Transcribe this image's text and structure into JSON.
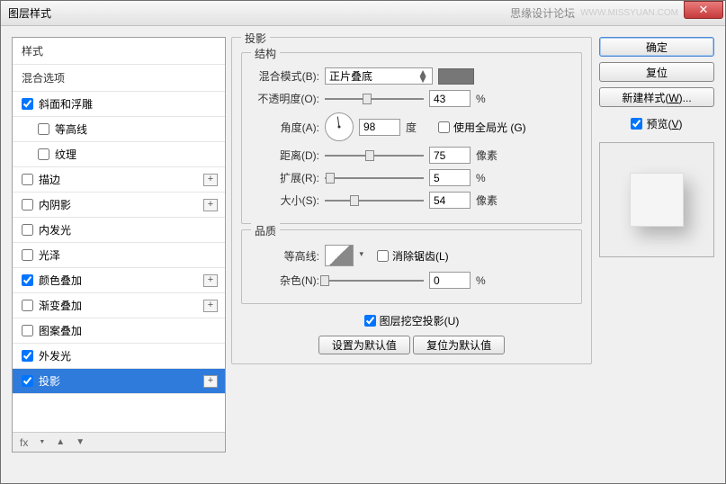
{
  "title": "图层样式",
  "forum": "思缘设计论坛",
  "watermark": "WWW.MISSYUAN.COM",
  "styles": {
    "header": "样式",
    "blendOptions": "混合选项",
    "items": [
      {
        "label": "斜面和浮雕",
        "checked": true,
        "plus": false,
        "sub": false
      },
      {
        "label": "等高线",
        "checked": false,
        "plus": false,
        "sub": true
      },
      {
        "label": "纹理",
        "checked": false,
        "plus": false,
        "sub": true
      },
      {
        "label": "描边",
        "checked": false,
        "plus": true,
        "sub": false
      },
      {
        "label": "内阴影",
        "checked": false,
        "plus": true,
        "sub": false
      },
      {
        "label": "内发光",
        "checked": false,
        "plus": false,
        "sub": false
      },
      {
        "label": "光泽",
        "checked": false,
        "plus": false,
        "sub": false
      },
      {
        "label": "颜色叠加",
        "checked": true,
        "plus": true,
        "sub": false
      },
      {
        "label": "渐变叠加",
        "checked": false,
        "plus": true,
        "sub": false
      },
      {
        "label": "图案叠加",
        "checked": false,
        "plus": false,
        "sub": false
      },
      {
        "label": "外发光",
        "checked": true,
        "plus": false,
        "sub": false
      },
      {
        "label": "投影",
        "checked": true,
        "plus": true,
        "sub": false,
        "active": true
      }
    ],
    "footer_fx": "fx"
  },
  "panel": {
    "title": "投影",
    "structure": "结构",
    "blendMode": {
      "label": "混合模式(B):",
      "value": "正片叠底"
    },
    "opacity": {
      "label": "不透明度(O):",
      "value": "43",
      "unit": "%",
      "pos": 43
    },
    "angle": {
      "label": "角度(A):",
      "value": "98",
      "unit": "度"
    },
    "globalLight": "使用全局光 (G)",
    "distance": {
      "label": "距离(D):",
      "value": "75",
      "unit": "像素",
      "pos": 45
    },
    "spread": {
      "label": "扩展(R):",
      "value": "5",
      "unit": "%",
      "pos": 5
    },
    "size": {
      "label": "大小(S):",
      "value": "54",
      "unit": "像素",
      "pos": 30
    },
    "quality": "品质",
    "contour": {
      "label": "等高线:"
    },
    "antialias": "消除锯齿(L)",
    "noise": {
      "label": "杂色(N):",
      "value": "0",
      "unit": "%",
      "pos": 0
    },
    "knockout": "图层挖空投影(U)",
    "setDefault": "设置为默认值",
    "resetDefault": "复位为默认值"
  },
  "buttons": {
    "ok": "确定",
    "cancel": "复位",
    "newStyle": "新建样式(W)...",
    "preview": "预览(V)"
  }
}
